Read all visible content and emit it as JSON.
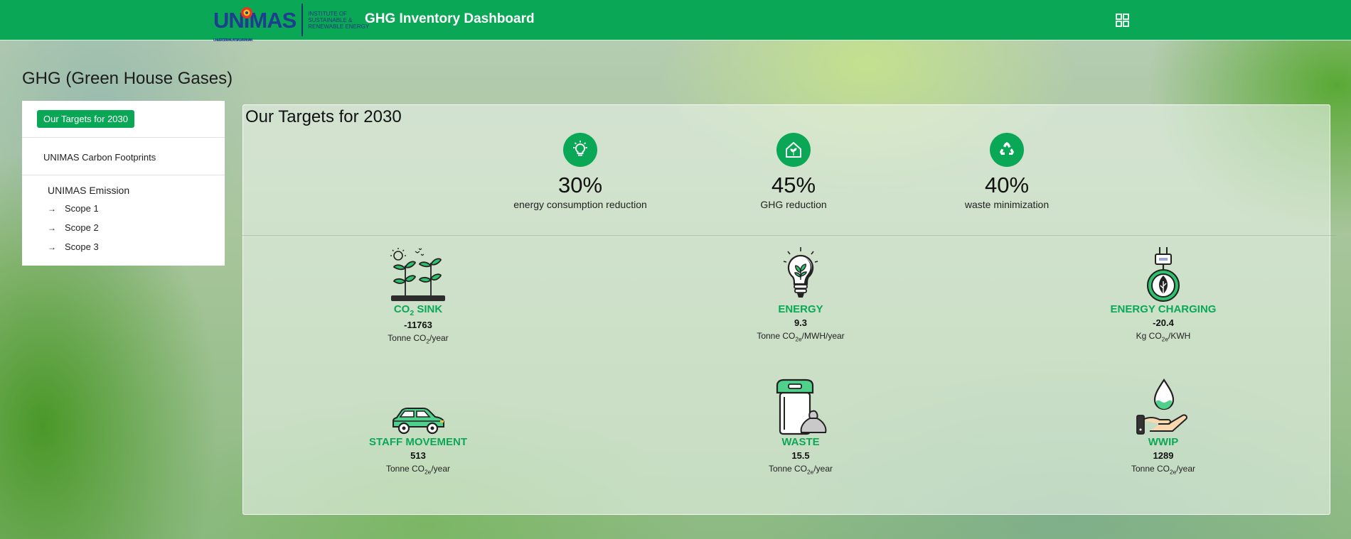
{
  "header": {
    "logo_text": "UNIMAS",
    "logo_tagline": "UNIVERSITI MALAYSIA SARAWAK",
    "institute": [
      "INSTITUTE OF",
      "SUSTAINABLE &",
      "RENEWABLE ENERGY"
    ],
    "app_title": "GHG Inventory Dashboard",
    "menu_icon": "grid-icon"
  },
  "page_title": "GHG (Green House Gases)",
  "sidebar": {
    "active_label": "Our Targets for 2030",
    "carbon_link": "UNIMAS Carbon Footprints",
    "emission_section": "UNIMAS Emission",
    "scopes": [
      "Scope 1",
      "Scope 2",
      "Scope 3"
    ]
  },
  "panel": {
    "title": "Our Targets for 2030",
    "targets": [
      {
        "pct": "30%",
        "label": "energy consumption reduction",
        "icon": "lightbulb-icon"
      },
      {
        "pct": "45%",
        "label": "GHG reduction",
        "icon": "green-house-icon"
      },
      {
        "pct": "40%",
        "label": "waste minimization",
        "icon": "recycle-icon"
      }
    ],
    "metrics": [
      {
        "name_main": "CO",
        "name_sub": "2",
        "name_rest": " SINK",
        "value": "-11763",
        "unit_pre": "Tonne CO",
        "unit_sub": "2",
        "unit_post": "/year",
        "icon": "plants-sink-icon"
      },
      {
        "name_main": "ENERGY",
        "name_sub": "",
        "name_rest": "",
        "value": "9.3",
        "unit_pre": "Tonne CO",
        "unit_sub": "2e",
        "unit_post": "/MWH/year",
        "icon": "eco-bulb-icon"
      },
      {
        "name_main": "ENERGY CHARGING",
        "name_sub": "",
        "name_rest": "",
        "value": "-20.4",
        "unit_pre": "Kg CO",
        "unit_sub": "2e",
        "unit_post": "/KWH",
        "icon": "plug-leaf-icon"
      },
      {
        "name_main": "STAFF MOVEMENT",
        "name_sub": "",
        "name_rest": "",
        "value": "513",
        "unit_pre": "Tonne CO",
        "unit_sub": "2e",
        "unit_post": "/year",
        "icon": "car-icon"
      },
      {
        "name_main": "WASTE",
        "name_sub": "",
        "name_rest": "",
        "value": "15.5",
        "unit_pre": "Tonne CO",
        "unit_sub": "2e",
        "unit_post": "/year",
        "icon": "trash-bin-icon"
      },
      {
        "name_main": "WWIP",
        "name_sub": "",
        "name_rest": "",
        "value": "1289",
        "unit_pre": "Tonne CO",
        "unit_sub": "2e",
        "unit_post": "/year",
        "icon": "water-hand-icon"
      }
    ]
  },
  "colors": {
    "brand_green": "#0aa856",
    "logo_blue": "#1d3f8e"
  }
}
